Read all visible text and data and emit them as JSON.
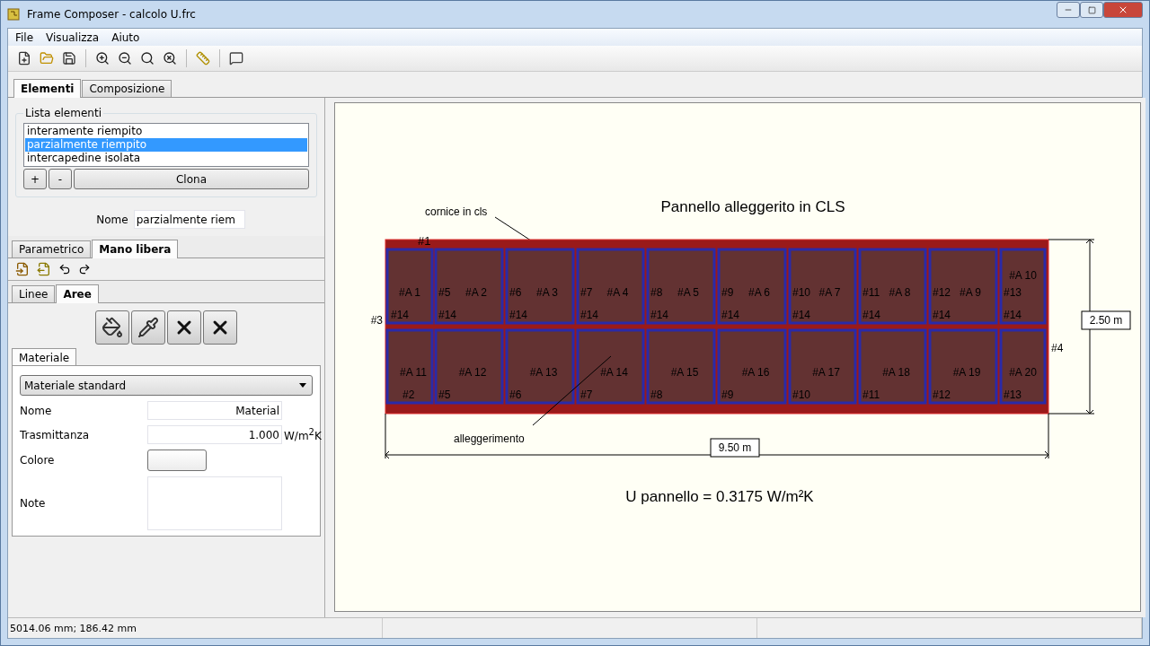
{
  "window": {
    "title": "Frame Composer - calcolo U.frc"
  },
  "menu": [
    "File",
    "Visualizza",
    "Aiuto"
  ],
  "main_tabs": [
    {
      "label": "Elementi",
      "selected": true
    },
    {
      "label": "Composizione",
      "selected": false
    }
  ],
  "elements_group": {
    "title": "Lista elementi",
    "items": [
      {
        "label": "interamente riempito",
        "selected": false
      },
      {
        "label": "parzialmente riempito",
        "selected": true
      },
      {
        "label": "intercapedine isolata",
        "selected": false
      }
    ],
    "buttons": [
      "+",
      "-",
      "Clona"
    ]
  },
  "name_field": {
    "label": "Nome",
    "value": "parzialmente riem"
  },
  "mode_tabs": [
    {
      "label": "Parametrico",
      "selected": false
    },
    {
      "label": "Mano libera",
      "selected": true
    }
  ],
  "shape_tabs": [
    {
      "label": "Linee",
      "selected": false
    },
    {
      "label": "Aree",
      "selected": true
    }
  ],
  "material_tabs": [
    {
      "label": "Materiale",
      "selected": true
    }
  ],
  "material": {
    "preset": "Materiale standard",
    "fields": [
      {
        "kind": "text",
        "label": "Nome",
        "value": "Material"
      },
      {
        "kind": "text",
        "label": "Trasmittanza",
        "value": "1.000",
        "unit": "W/m$^{2}$K"
      },
      {
        "kind": "color",
        "label": "Colore"
      },
      {
        "kind": "memo",
        "label": "Note"
      }
    ]
  },
  "canvas": {
    "title": "Pannello alleggerito in CLS",
    "frame_label": "cornice in cls",
    "void_label": "alleggerimento",
    "width_dim": "9.50 m",
    "height_dim": "2.50 m",
    "result": "U pannello = 0.3175 W/m²K",
    "edges": {
      "top": "#1",
      "left": "#3",
      "left_middle": "#14",
      "bottom": "#2",
      "right": "#4"
    },
    "cells": [
      {
        "top": "#A 1",
        "bottom": "#A 11"
      },
      {
        "top": "#A 2",
        "bottom": "#A 12"
      },
      {
        "top": "#A 3",
        "bottom": "#A 13"
      },
      {
        "top": "#A 4",
        "bottom": "#A 14"
      },
      {
        "top": "#A 5",
        "bottom": "#A 15"
      },
      {
        "top": "#A 6",
        "bottom": "#A 16"
      },
      {
        "top": "#A 7",
        "bottom": "#A 17"
      },
      {
        "top": "#A 8",
        "bottom": "#A 18"
      },
      {
        "top": "#A 9",
        "bottom": "#A 19"
      },
      {
        "top": "#A 10",
        "bottom": "#A 20"
      }
    ],
    "dividers": [
      {
        "top": "#5",
        "middle": "#14",
        "bottom": "#5"
      },
      {
        "top": "#6",
        "middle": "#14",
        "bottom": "#6"
      },
      {
        "top": "#7",
        "middle": "#14",
        "bottom": "#7"
      },
      {
        "top": "#8",
        "middle": "#14",
        "bottom": "#8"
      },
      {
        "top": "#9",
        "middle": "#14",
        "bottom": "#9"
      },
      {
        "top": "#10",
        "middle": "#14",
        "bottom": "#10"
      },
      {
        "top": "#11",
        "middle": "#14",
        "bottom": "#11"
      },
      {
        "top": "#12",
        "middle": "#14",
        "bottom": "#12"
      },
      {
        "top": "#13",
        "middle": "#14",
        "bottom": "#13"
      }
    ]
  },
  "status_bar": {
    "coordinates": "5014.06 mm; 186.42 mm"
  }
}
